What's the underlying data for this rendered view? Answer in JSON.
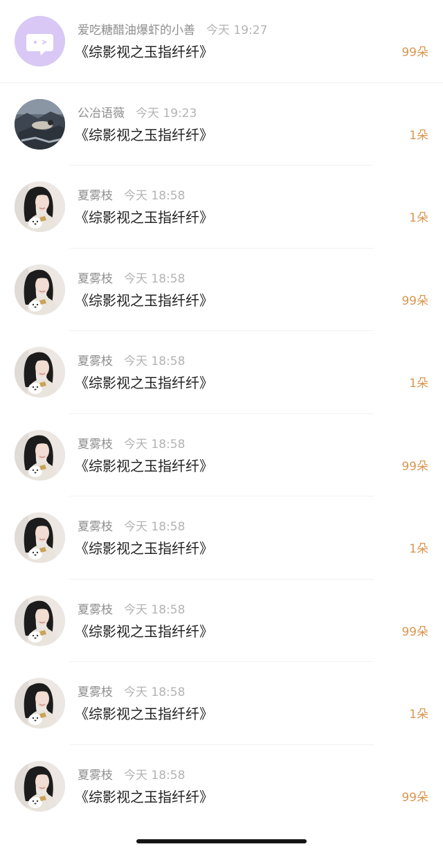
{
  "comments": [
    {
      "user": "爱吃糖醋油爆虾的小善",
      "time": "今天 19:27",
      "title": "《综影视之玉指纤纤》",
      "count": "99朵",
      "avatar": "purple-chat-icon"
    },
    {
      "user": "公冶语薇",
      "time": "今天 19:23",
      "title": "《综影视之玉指纤纤》",
      "count": "1朵",
      "avatar": "photo-avatar"
    },
    {
      "user": "夏雾枝",
      "time": "今天 18:58",
      "title": "《综影视之玉指纤纤》",
      "count": "1朵",
      "avatar": "portrait-avatar"
    },
    {
      "user": "夏雾枝",
      "time": "今天 18:58",
      "title": "《综影视之玉指纤纤》",
      "count": "99朵",
      "avatar": "portrait-avatar"
    },
    {
      "user": "夏雾枝",
      "time": "今天 18:58",
      "title": "《综影视之玉指纤纤》",
      "count": "1朵",
      "avatar": "portrait-avatar"
    },
    {
      "user": "夏雾枝",
      "time": "今天 18:58",
      "title": "《综影视之玉指纤纤》",
      "count": "99朵",
      "avatar": "portrait-avatar"
    },
    {
      "user": "夏雾枝",
      "time": "今天 18:58",
      "title": "《综影视之玉指纤纤》",
      "count": "1朵",
      "avatar": "portrait-avatar"
    },
    {
      "user": "夏雾枝",
      "time": "今天 18:58",
      "title": "《综影视之玉指纤纤》",
      "count": "99朵",
      "avatar": "portrait-avatar"
    },
    {
      "user": "夏雾枝",
      "time": "今天 18:58",
      "title": "《综影视之玉指纤纤》",
      "count": "1朵",
      "avatar": "portrait-avatar"
    },
    {
      "user": "夏雾枝",
      "time": "今天 18:58",
      "title": "《综影视之玉指纤纤》",
      "count": "99朵",
      "avatar": "portrait-avatar"
    }
  ],
  "colors": {
    "count_accent": "#d9964f",
    "avatar_purple": "#d9c8f5"
  }
}
